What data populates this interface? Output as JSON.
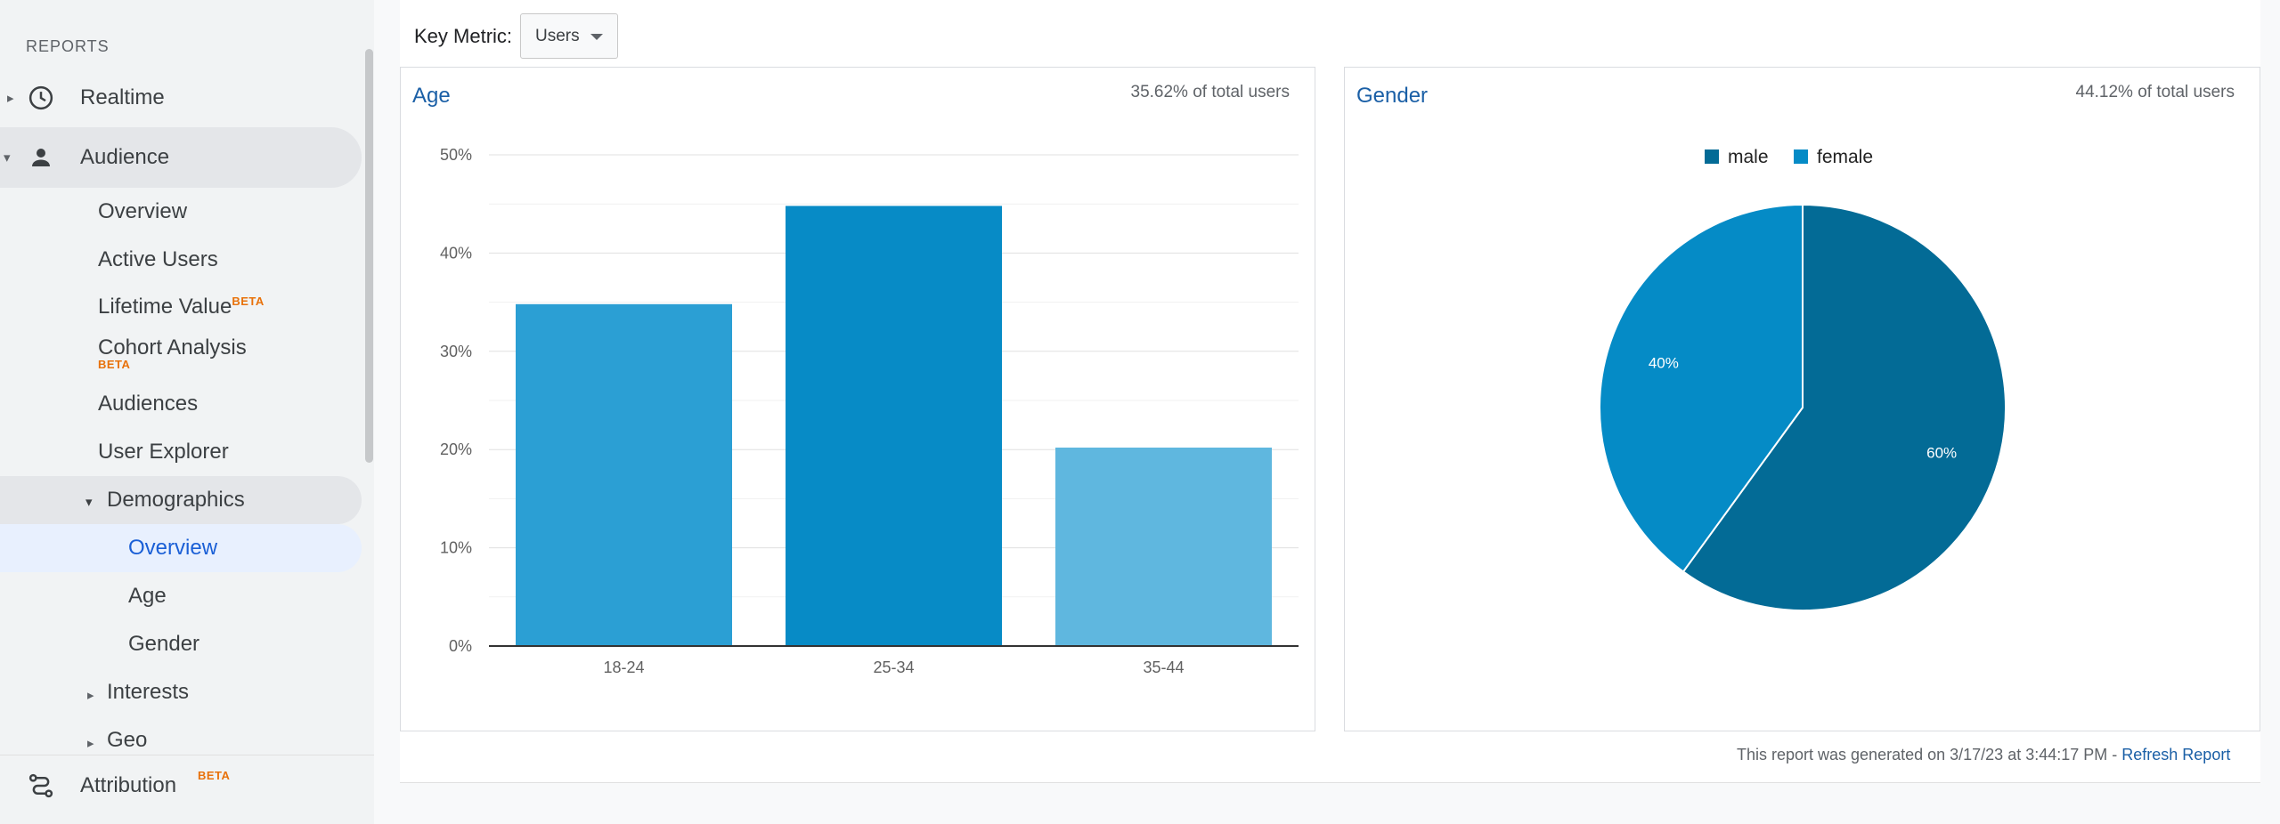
{
  "sidebar": {
    "section_label": "REPORTS",
    "realtime": "Realtime",
    "audience": "Audience",
    "audience_items": [
      {
        "label": "Overview"
      },
      {
        "label": "Active Users"
      },
      {
        "label": "Lifetime Value",
        "badge": "BETA"
      },
      {
        "label": "Cohort Analysis",
        "badge": "BETA"
      },
      {
        "label": "Audiences"
      },
      {
        "label": "User Explorer"
      }
    ],
    "demographics": "Demographics",
    "demographics_items": [
      "Overview",
      "Age",
      "Gender"
    ],
    "interests": "Interests",
    "geo": "Geo",
    "attribution": "Attribution",
    "attribution_badge": "BETA"
  },
  "toolbar": {
    "key_metric_label": "Key Metric:",
    "key_metric_value": "Users"
  },
  "age_panel": {
    "title": "Age",
    "subtitle": "35.62% of total users"
  },
  "gender_panel": {
    "title": "Gender",
    "subtitle": "44.12% of total users"
  },
  "footer": {
    "generated_text": "This report was generated on 3/17/23 at 3:44:17 PM - ",
    "refresh_link": "Refresh Report"
  },
  "chart_data": [
    {
      "type": "bar",
      "title": "Age",
      "categories": [
        "18-24",
        "25-34",
        "35-44"
      ],
      "values": [
        34.8,
        44.8,
        20.2
      ],
      "colors": [
        "#2b9fd4",
        "#078bc6",
        "#5fb7df"
      ],
      "ylim": [
        0,
        50
      ],
      "yticks": [
        0,
        10,
        20,
        30,
        40,
        50
      ],
      "ytick_labels": [
        "0%",
        "10%",
        "20%",
        "30%",
        "40%",
        "50%"
      ],
      "grid": true
    },
    {
      "type": "pie",
      "title": "Gender",
      "legend": [
        "male",
        "female"
      ],
      "legend_placement": "top",
      "values": [
        60,
        40
      ],
      "labels": [
        "60%",
        "40%"
      ],
      "colors": [
        "#036b96",
        "#058bc6"
      ]
    }
  ]
}
